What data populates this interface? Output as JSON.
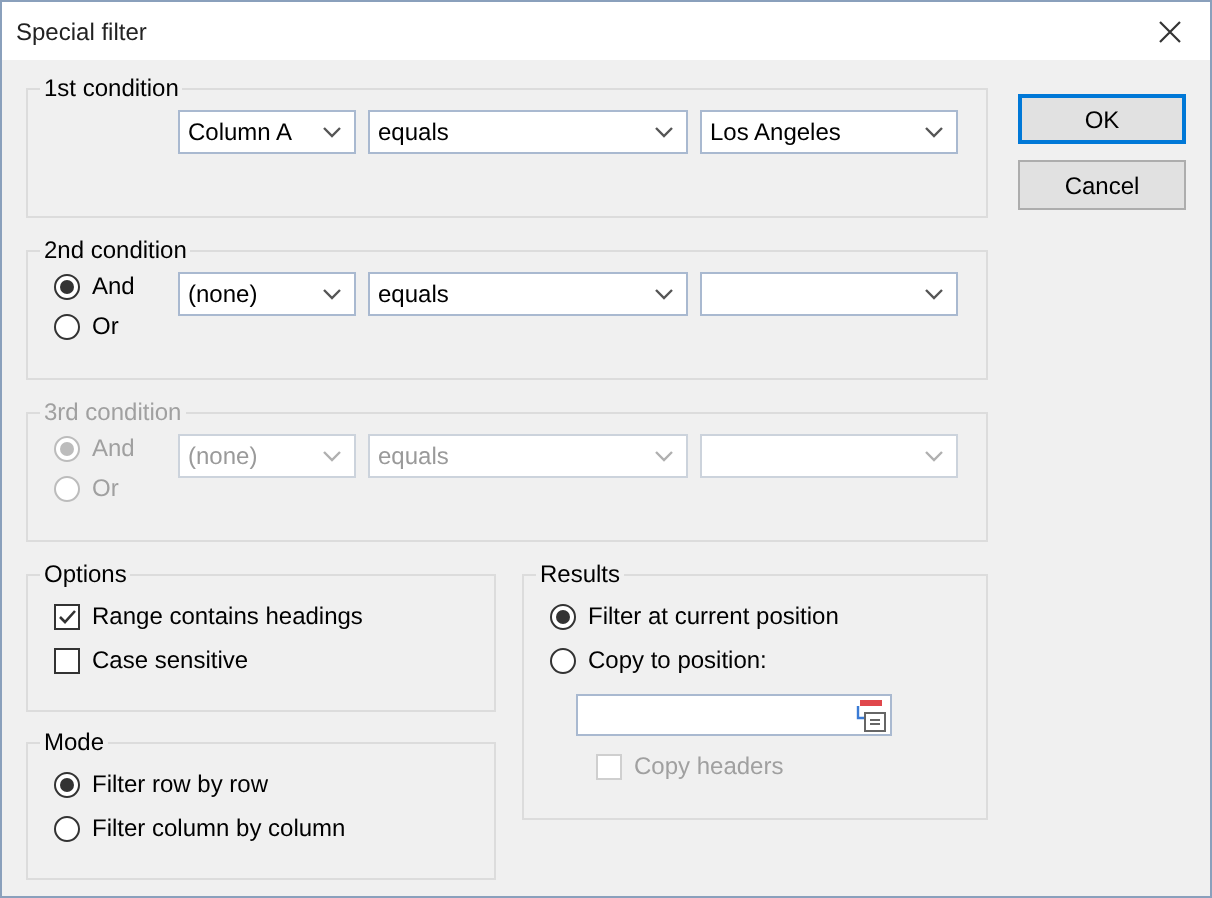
{
  "window": {
    "title": "Special filter"
  },
  "conditions": [
    {
      "title": "1st condition",
      "disabled": false,
      "field": "Column A",
      "operator": "equals",
      "value": "Los Angeles"
    },
    {
      "title": "2nd condition",
      "disabled": false,
      "connectors": [
        {
          "label": "And",
          "selected": true
        },
        {
          "label": "Or",
          "selected": false
        }
      ],
      "field": "(none)",
      "operator": "equals"
    },
    {
      "title": "3rd condition",
      "disabled": true,
      "connectors": [
        {
          "label": "And",
          "selected": true
        },
        {
          "label": "Or",
          "selected": false
        }
      ],
      "field": "(none)",
      "operator": "equals"
    }
  ],
  "options": {
    "title": "Options",
    "items": [
      {
        "label": "Range contains headings",
        "checked": true
      },
      {
        "label": "Case sensitive",
        "checked": false
      }
    ]
  },
  "mode": {
    "title": "Mode",
    "items": [
      {
        "label": "Filter row by row",
        "selected": true
      },
      {
        "label": "Filter column by column",
        "selected": false
      }
    ]
  },
  "results": {
    "title": "Results",
    "items": [
      {
        "label": "Filter at current position",
        "selected": true
      },
      {
        "label": "Copy to position:",
        "selected": false
      }
    ],
    "copy_headers": {
      "label": "Copy headers",
      "checked": false,
      "disabled": true
    }
  },
  "buttons": [
    {
      "label": "OK",
      "default": true
    },
    {
      "label": "Cancel",
      "default": false
    }
  ]
}
